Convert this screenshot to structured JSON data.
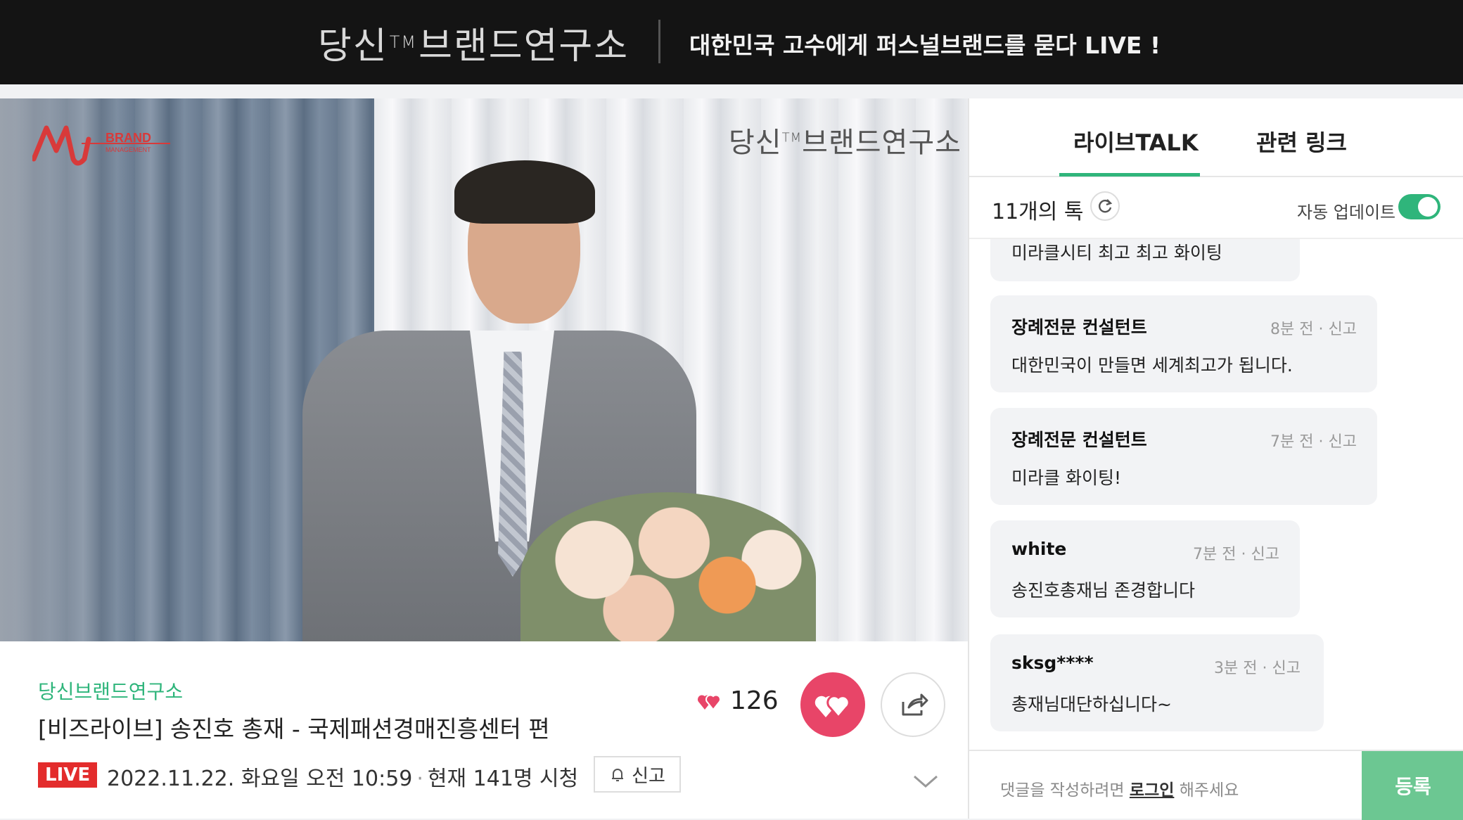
{
  "header": {
    "logo_text": "당신브랜드연구소",
    "logo_tm": "TM",
    "tagline": "대한민국 고수에게 퍼스널브랜드를 묻다 LIVE !"
  },
  "video": {
    "watermark_text": "당신브랜드연구소",
    "watermark_tm": "TM",
    "brand_mark_text": "BRAND",
    "brand_mark_sub": "MANAGEMENT",
    "colors": {
      "brand_red": "#d83a3a"
    }
  },
  "stream": {
    "channel": "당신브랜드연구소",
    "title": "[비즈라이브] 송진호 총재 - 국제패션경매진흥센터 편",
    "live_label": "LIVE",
    "datetime": "2022.11.22. 화요일 오전 10:59",
    "viewers": "현재 141명 시청",
    "report_label": "신고",
    "like_count": "126"
  },
  "sidebar": {
    "tabs": [
      {
        "label": "라이브TALK",
        "active": true
      },
      {
        "label": "관련 링크",
        "active": false
      }
    ],
    "talk_count": "11개의 톡",
    "auto_update_label": "자동 업데이트",
    "auto_update_on": true,
    "messages": [
      {
        "author": "",
        "time": "",
        "report": "",
        "body": "미라클시티 최고 최고 화이팅"
      },
      {
        "author": "장례전문 컨설턴트",
        "time": "8분 전",
        "report": "신고",
        "body": "대한민국이 만들면 세계최고가 됩니다."
      },
      {
        "author": "장례전문 컨설턴트",
        "time": "7분 전",
        "report": "신고",
        "body": "미라클 화이팅!"
      },
      {
        "author": "white",
        "time": "7분 전",
        "report": "신고",
        "body": "송진호총재님 존경합니다"
      },
      {
        "author": "sksg****",
        "time": "3분 전",
        "report": "신고",
        "body": "총재님대단하십니다~"
      }
    ],
    "comment": {
      "placeholder_pre": "댓글을 작성하려면 ",
      "placeholder_login": "로그인",
      "placeholder_post": " 해주세요",
      "submit_label": "등록"
    }
  },
  "colors": {
    "accent": "#2fb57b",
    "like": "#e84568",
    "live": "#e32c2c",
    "submit": "#6cc792"
  }
}
